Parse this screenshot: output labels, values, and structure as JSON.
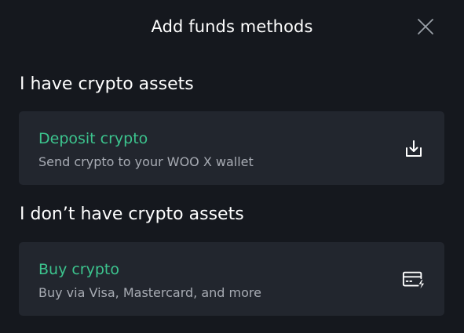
{
  "header": {
    "title": "Add funds methods"
  },
  "sections": [
    {
      "title": "I have crypto assets",
      "option": {
        "title": "Deposit crypto",
        "subtitle": "Send crypto to your WOO X wallet",
        "icon": "download-icon"
      }
    },
    {
      "title": "I don’t have crypto assets",
      "option": {
        "title": "Buy crypto",
        "subtitle": "Buy via Visa, Mastercard, and more",
        "icon": "card-flash-icon"
      }
    }
  ],
  "colors": {
    "background": "#15181e",
    "card": "#22262e",
    "accent": "#3cc48e",
    "muted_text": "#a7abb3"
  }
}
